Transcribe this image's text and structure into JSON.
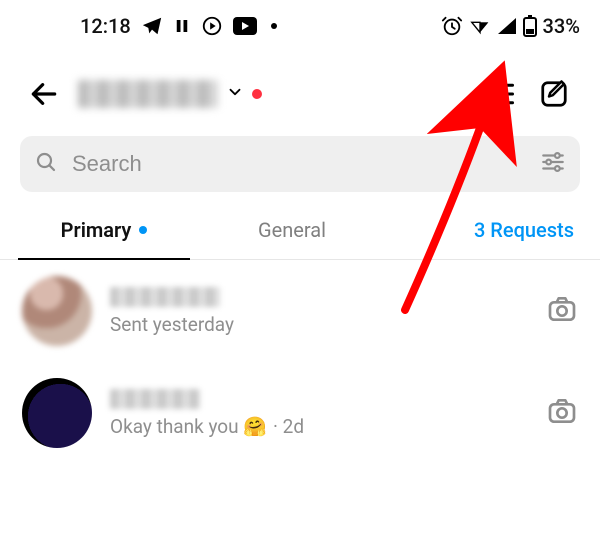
{
  "status": {
    "time": "12:18",
    "battery_text": "33%"
  },
  "header": {
    "username_redacted": true
  },
  "search": {
    "placeholder": "Search"
  },
  "tabs": {
    "primary": "Primary",
    "general": "General",
    "requests": "3 Requests"
  },
  "conversations": [
    {
      "preview": "Sent yesterday",
      "time_suffix": ""
    },
    {
      "preview": "Okay thank you 🤗",
      "time_suffix": "· 2d"
    }
  ]
}
